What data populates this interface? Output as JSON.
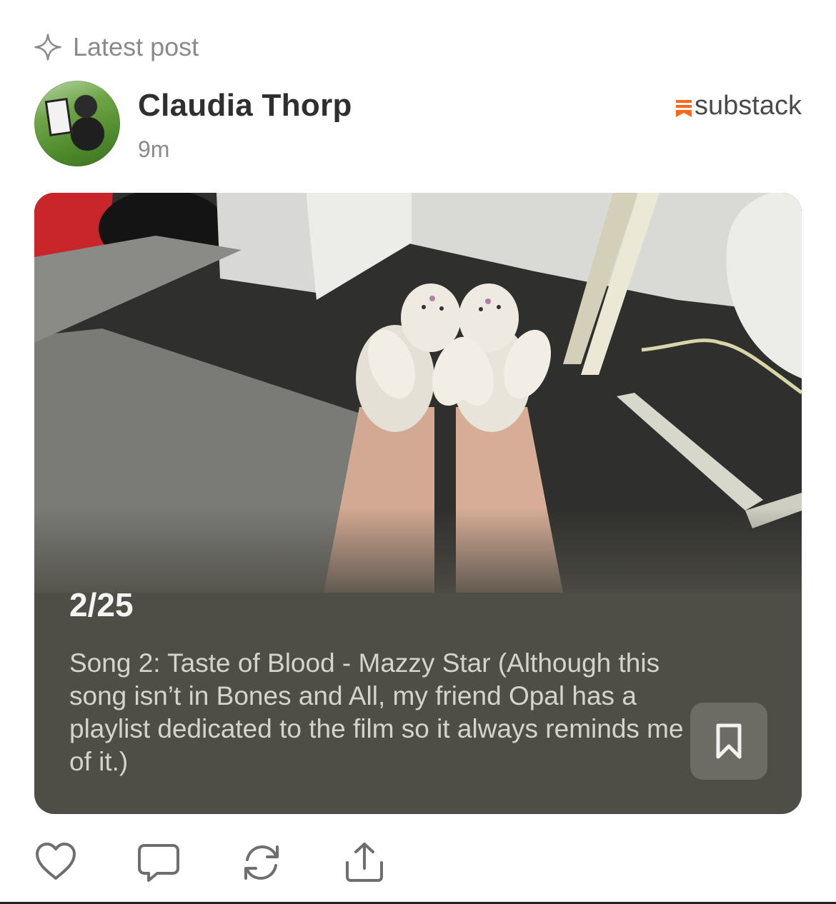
{
  "section": {
    "label": "Latest post",
    "icon": "sparkle-icon"
  },
  "author": {
    "name": "Claudia Thorp",
    "time": "9m"
  },
  "brand": {
    "name": "substack",
    "icon": "substack-logo-icon",
    "color": "#ff6719"
  },
  "post": {
    "title": "2/25",
    "excerpt": "Song 2: Taste of Blood - Mazzy Star (Although this song isn’t in Bones and All, my friend Opal has a playlist dedicated to the film so it always reminds me of it.)",
    "image": "photo of feet in white bunny slippers on carpet"
  },
  "actions": [
    {
      "name": "like",
      "icon": "heart-icon"
    },
    {
      "name": "comment",
      "icon": "comment-icon"
    },
    {
      "name": "restack",
      "icon": "restack-icon"
    },
    {
      "name": "share",
      "icon": "share-icon"
    }
  ],
  "colors": {
    "card_bg": "#4f4e46",
    "bookmark_bg": "#6c6b64",
    "muted_text": "#8a8a8a"
  }
}
